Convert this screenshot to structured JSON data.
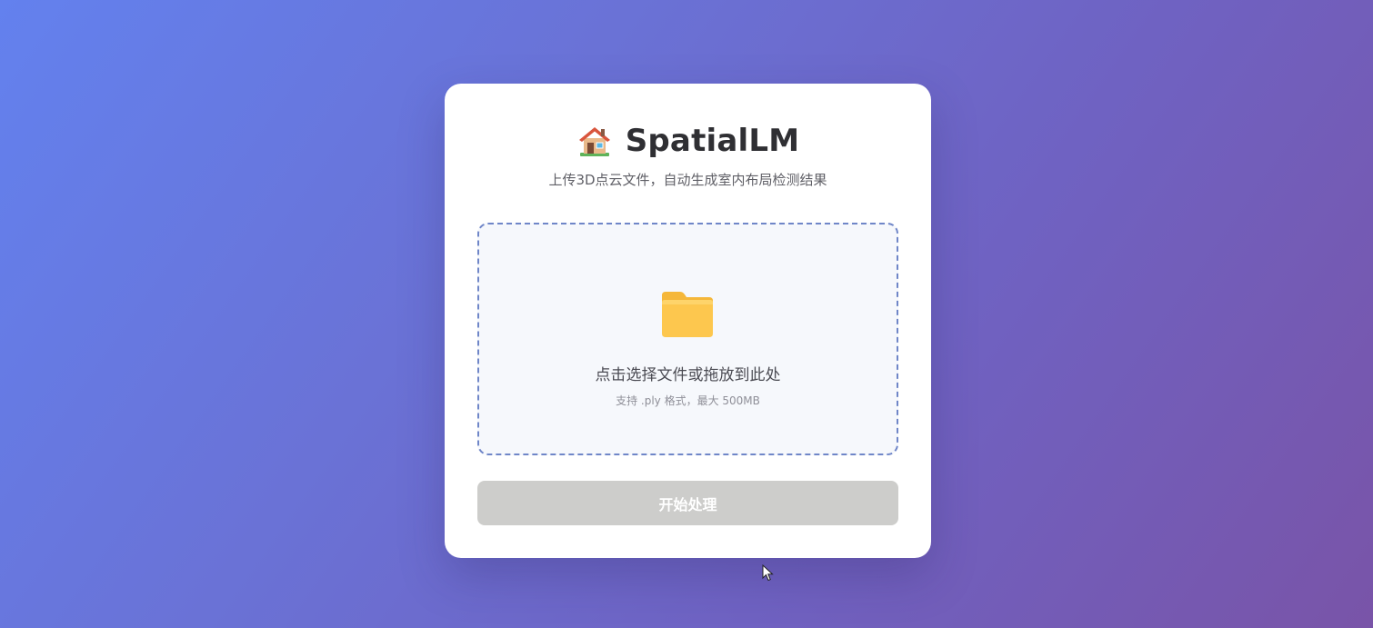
{
  "header": {
    "icon": "house-icon",
    "title": "SpatialLM",
    "subtitle": "上传3D点云文件，自动生成室内布局检测结果"
  },
  "dropzone": {
    "icon": "folder-icon",
    "main_text": "点击选择文件或拖放到此处",
    "hint_text": "支持 .ply 格式，最大 500MB"
  },
  "actions": {
    "start_label": "开始处理"
  },
  "colors": {
    "gradient_start": "#6381ee",
    "gradient_end": "#7954a8",
    "card": "#ffffff",
    "dropzone_border": "#6f86c8",
    "dropzone_bg": "#f6f8fc",
    "button_disabled": "#cdcdcb"
  }
}
